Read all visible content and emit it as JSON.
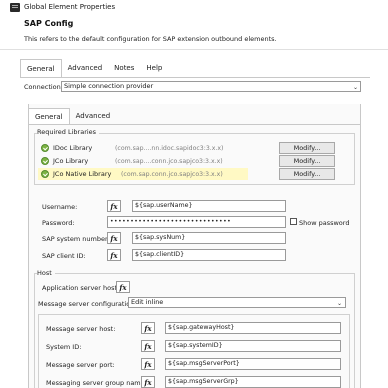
{
  "window": {
    "title": "Global Element Properties"
  },
  "header": {
    "title": "SAP Config",
    "description": "This refers to the default configuration for SAP extension outbound elements."
  },
  "outer_tabs": [
    {
      "label": "General",
      "active": true
    },
    {
      "label": "Advanced",
      "active": false
    },
    {
      "label": "Notes",
      "active": false
    },
    {
      "label": "Help",
      "active": false
    }
  ],
  "connection": {
    "label": "Connection",
    "value": "Simple connection provider"
  },
  "inner_tabs": [
    {
      "label": "General",
      "active": true
    },
    {
      "label": "Advanced",
      "active": false
    }
  ],
  "required_libraries": {
    "title": "Required Libraries",
    "items": [
      {
        "name": "IDoc Library",
        "path": "(com.sap....nn.idoc.sapidoc3:3.x.x)",
        "button": "Modify..."
      },
      {
        "name": "JCo Library",
        "path": "(com.sap....conn.jco.sapjco3:3.x.x)",
        "button": "Modify..."
      },
      {
        "name": "JCo Native Library",
        "path": "(com.sap.conn.jco.sapjco3:3.x.x)",
        "button": "Modify..."
      }
    ]
  },
  "credentials": {
    "username": {
      "label": "Username:",
      "value": "${sap.userName}"
    },
    "password": {
      "label": "Password:",
      "value": "••••••••••••••••••••••••••••••",
      "show_label": "Show password"
    },
    "system_number": {
      "label": "SAP system number:",
      "value": "${sap.sysNum}"
    },
    "client_id": {
      "label": "SAP client ID:",
      "value": "${sap.clientID}"
    },
    "fx": "fx"
  },
  "host": {
    "title": "Host",
    "app_server_label": "Application server host:",
    "msg_server_config_label": "Message server configuration",
    "msg_server_config_value": "Edit inline",
    "fields": [
      {
        "label": "Message server host:",
        "value": "${sap.gatewayHost}"
      },
      {
        "label": "System ID:",
        "value": "${sap.systemID}"
      },
      {
        "label": "Message server port:",
        "value": "${sap.msgServerPort}"
      },
      {
        "label": "Messaging server group name:",
        "value": "${sap.msgServerGrp}"
      }
    ]
  },
  "icons": {
    "app": "window-icon",
    "check": "check-circle-icon",
    "chevron": "chevron-down-icon"
  },
  "colors": {
    "library_check": "#7cb342",
    "highlight": "#fff9c4"
  }
}
